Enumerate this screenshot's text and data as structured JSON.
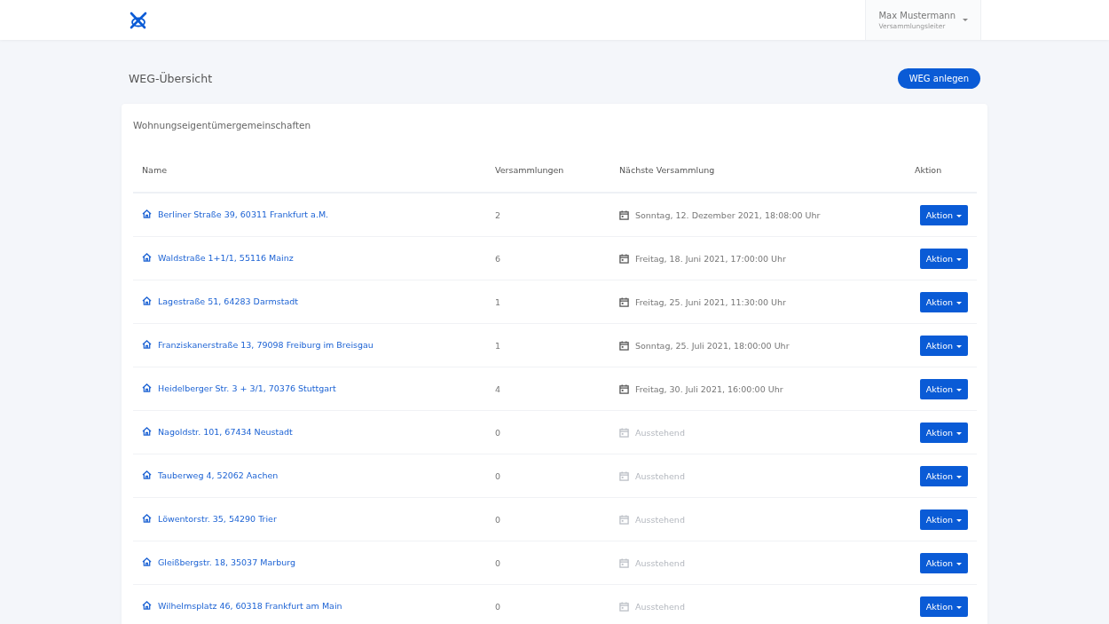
{
  "header": {
    "user": {
      "name": "Max Mustermann",
      "role": "Versammlungsleiter"
    }
  },
  "page": {
    "title": "WEG-Übersicht",
    "create_button": "WEG anlegen"
  },
  "card": {
    "title": "Wohnungseigentümergemeinschaften",
    "table": {
      "columns": [
        "Name",
        "Versammlungen",
        "Nächste Versammlung",
        "Aktion"
      ],
      "rows": [
        {
          "name": "Berliner Straße 39, 60311 Frankfurt a.M.",
          "count": "2",
          "next": "Sonntag, 12. Dezember 2021, 18:08:00 Uhr",
          "pending": false,
          "action": "Aktion"
        },
        {
          "name": "Waldstraße 1+1/1, 55116 Mainz",
          "count": "6",
          "next": "Freitag, 18. Juni 2021, 17:00:00 Uhr",
          "pending": false,
          "action": "Aktion"
        },
        {
          "name": "Lagestraße 51, 64283 Darmstadt",
          "count": "1",
          "next": "Freitag, 25. Juni 2021, 11:30:00 Uhr",
          "pending": false,
          "action": "Aktion"
        },
        {
          "name": "Franziskanerstraße 13, 79098 Freiburg im Breisgau",
          "count": "1",
          "next": "Sonntag, 25. Juli 2021, 18:00:00 Uhr",
          "pending": false,
          "action": "Aktion"
        },
        {
          "name": "Heidelberger Str. 3 + 3/1, 70376 Stuttgart",
          "count": "4",
          "next": "Freitag, 30. Juli 2021, 16:00:00 Uhr",
          "pending": false,
          "action": "Aktion"
        },
        {
          "name": "Nagoldstr. 101, 67434 Neustadt",
          "count": "0",
          "next": "Ausstehend",
          "pending": true,
          "action": "Aktion"
        },
        {
          "name": "Tauberweg 4, 52062 Aachen",
          "count": "0",
          "next": "Ausstehend",
          "pending": true,
          "action": "Aktion"
        },
        {
          "name": "Löwentorstr. 35, 54290 Trier",
          "count": "0",
          "next": "Ausstehend",
          "pending": true,
          "action": "Aktion"
        },
        {
          "name": "Gleißbergstr. 18, 35037 Marburg",
          "count": "0",
          "next": "Ausstehend",
          "pending": true,
          "action": "Aktion"
        },
        {
          "name": "Wilhelmsplatz 46, 60318 Frankfurt am Main",
          "count": "0",
          "next": "Ausstehend",
          "pending": true,
          "action": "Aktion"
        }
      ]
    }
  }
}
